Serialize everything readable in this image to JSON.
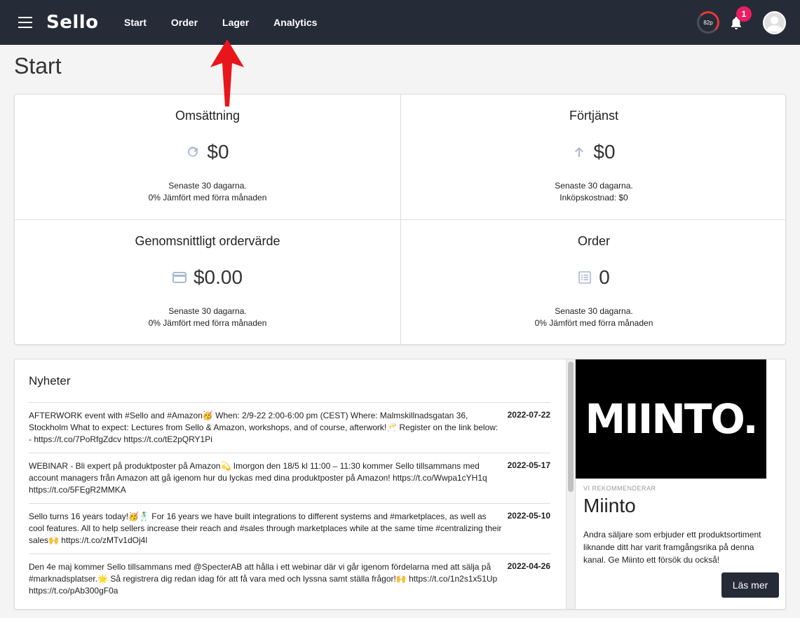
{
  "app": {
    "logo": "Sello"
  },
  "nav": {
    "items": [
      "Start",
      "Order",
      "Lager",
      "Analytics"
    ]
  },
  "header": {
    "speed_label": "82p",
    "notification_count": "1"
  },
  "page": {
    "title": "Start"
  },
  "stats": [
    {
      "title": "Omsättning",
      "value": "$0",
      "icon": "refresh-icon",
      "note1": "Senaste 30 dagarna.",
      "note2": "0% Jämfört med förra månaden"
    },
    {
      "title": "Förtjänst",
      "value": "$0",
      "icon": "arrow-up-icon",
      "note1": "Senaste 30 dagarna.",
      "note2": "Inköpskostnad: $0"
    },
    {
      "title": "Genomsnittligt ordervärde",
      "value": "$0.00",
      "icon": "credit-card-icon",
      "note1": "Senaste 30 dagarna.",
      "note2": "0% Jämfört med förra månaden"
    },
    {
      "title": "Order",
      "value": "0",
      "icon": "list-icon",
      "note1": "Senaste 30 dagarna.",
      "note2": "0% Jämfört med förra månaden"
    }
  ],
  "news": {
    "title": "Nyheter",
    "items": [
      {
        "text": "AFTERWORK event with #Sello and #Amazon🥳 When: 2/9-22 2:00-6:00 pm (CEST) Where: Malmskillnadsgatan 36, Stockholm What to expect: Lectures from Sello & Amazon, workshops, and of course, afterwork!🥂 Register on the link below: - https://t.co/7PoRfgZdcv https://t.co/tE2pQRY1Pi",
        "date": "2022-07-22"
      },
      {
        "text": "WEBINAR - Bli expert på produktposter på Amazon💫 Imorgon den 18/5 kl 11:00 – 11:30 kommer Sello tillsammans med account managers från Amazon att gå igenom hur du lyckas med dina produktposter på Amazon! https://t.co/Wwpa1cYH1q https://t.co/5FEgR2MMKA",
        "date": "2022-05-17"
      },
      {
        "text": "Sello turns 16 years today!🥳🕺 For 16 years we have built integrations to different systems and #marketplaces, as well as cool features. All to help sellers increase their reach and #sales through marketplaces while at the same time #centralizing their sales🙌 https://t.co/zMTv1dOj4l",
        "date": "2022-05-10"
      },
      {
        "text": "Den 4e maj kommer Sello tillsammans med @SpecterAB att hålla i ett webinar där vi går igenom fördelarna med att sälja på #marknadsplatser.🌟 Så registrera dig redan idag för att få vara med och lyssna samt ställa frågor!🙌 https://t.co/1n2s1x51Up https://t.co/pAb300gF0a",
        "date": "2022-04-26"
      }
    ]
  },
  "promo": {
    "image_text": "MIINTO.",
    "kicker": "VI REKOMMENDERAR",
    "name": "Miinto",
    "text": "Andra säljare som erbjuder ett produktsortiment liknande ditt har varit framgångsrika på denna kanal. Ge Miinto ett försök du också!",
    "button": "Läs mer"
  },
  "colors": {
    "topbar": "#262b38",
    "badge": "#e91e63",
    "arrow": "#e8161b",
    "icon": "#a9b9cf"
  }
}
